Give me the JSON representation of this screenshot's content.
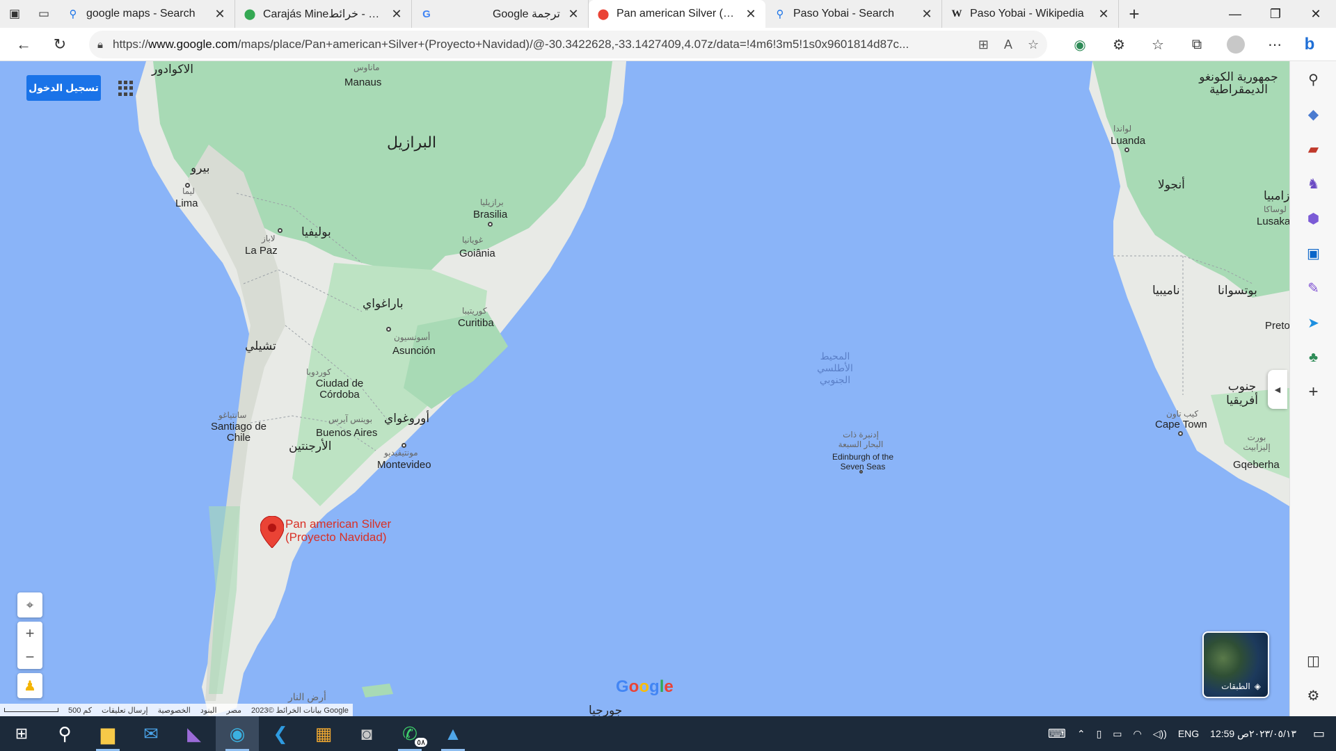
{
  "browser": {
    "tabs": [
      {
        "title": "google maps - Search",
        "icon": "search-icon"
      },
      {
        "title": "Carajás Mine‎خرائط‎ - Goog",
        "icon": "maps-pin-icon"
      },
      {
        "title": "Google ترجمة",
        "icon": "translate-icon"
      },
      {
        "title": "Pan american Silver (Proye",
        "icon": "maps-pin-icon",
        "active": true
      },
      {
        "title": "Paso Yobai - Search",
        "icon": "search-icon"
      },
      {
        "title": "Paso Yobai - Wikipedia",
        "icon": "wikipedia-icon"
      }
    ],
    "url_prefix": "https://",
    "url_host": "www.google.com",
    "url_path": "/maps/place/Pan+american+Silver+(Proyecto+Navidad)/@-30.3422628,-33.1427409,4.07z/data=!4m6!3m5!1s0x9601814d87c..."
  },
  "map": {
    "signin_label": "تسجيل الدخول",
    "pin_label_line1": "Pan american Silver",
    "pin_label_line2": "(Proyecto Navidad)",
    "ocean_label": [
      "المحيط",
      "الأطلسي",
      "الجنوبي"
    ],
    "layers_label": "الطبقات",
    "google_logo": "Google",
    "labels": {
      "ecuador": "الاكوادور",
      "manaus_ar": "ماناوس",
      "manaus": "Manaus",
      "brazil": "البرازيل",
      "peru": "بيرو",
      "lima_ar": "ليما",
      "lima": "Lima",
      "bolivia": "بوليفيا",
      "lapaz_ar": "لاباز",
      "lapaz": "La Paz",
      "brasilia_ar": "برازيليا",
      "brasilia": "Brasilia",
      "goiania_ar": "غويانيا",
      "goiania": "Goiânia",
      "paraguay": "باراغواي",
      "asuncion_ar": "أسونسيون",
      "asuncion": "Asunción",
      "curitiba_ar": "كوريتيبا",
      "curitiba": "Curitiba",
      "chile": "تشيلي",
      "cordoba_ar": "كوردوبا",
      "cordoba": "Ciudad de Córdoba",
      "santiago_ar": "سانتياغو",
      "santiago": "Santiago de Chile",
      "buenos_ar": "بوينس آيرس",
      "buenos": "Buenos Aires",
      "uruguay": "أوروغواي",
      "argentina": "الأرجنتين",
      "montevideo_ar": "مونتيفيديو",
      "montevideo": "Montevideo",
      "congo": "جمهورية الكونغو الديمقراطية",
      "luanda_ar": "لواندا",
      "luanda": "Luanda",
      "angola": "أنجولا",
      "zambia": "زامبيا",
      "lusaka_ar": "لوساكا",
      "lusaka": "Lusaka",
      "namibia": "ناميبيا",
      "botswana": "بوتسوانا",
      "pretoria": "Preto",
      "south_africa": "جنوب أفريقيا",
      "capetown_ar": "كيب تاون",
      "capetown": "Cape Town",
      "gqeberha_ar": "بورت إليزابيث",
      "gqeberha": "Gqeberha",
      "tristan_ar": "إدنبرة ذات البحار السبعة",
      "tristan": "Edinburgh of the Seven Seas",
      "georgia": "جورجيا",
      "fireland": "أرض النار"
    },
    "footer": {
      "scale": "500 كم",
      "feedback": "إرسال تعليقات",
      "privacy": "الخصوصية",
      "terms": "البنود",
      "country": "مصر",
      "data": "بيانات الخرائط ©2023 Google"
    }
  },
  "taskbar": {
    "clock_time": "12:59 ص",
    "clock_date": "٢٠٢٣/٠٥/١٣",
    "lang": "ENG",
    "whatsapp_badge": "٥٨"
  },
  "colors": {
    "water": "#8ab4f8",
    "land": "#e8eae6",
    "forest": "#a8dab5",
    "accent": "#1a73e8",
    "pin": "#ea4335"
  }
}
